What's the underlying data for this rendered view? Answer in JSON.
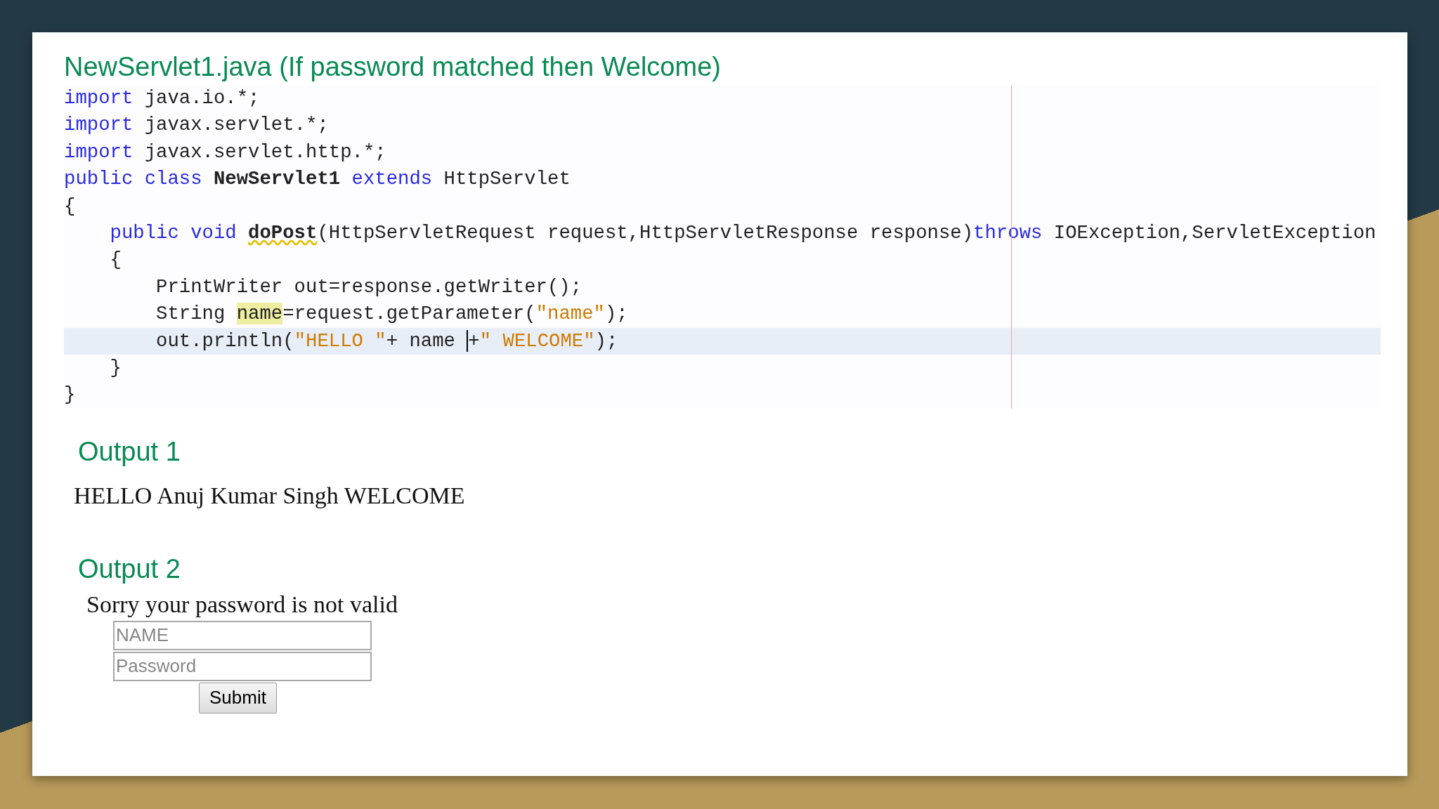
{
  "title": "NewServlet1.java (If password matched then Welcome)",
  "code": {
    "lines": [
      {
        "current": false,
        "tokens": [
          {
            "kind": "keyword",
            "text": "import"
          },
          {
            "kind": "plain",
            "text": " java.io.*;"
          }
        ]
      },
      {
        "current": false,
        "tokens": [
          {
            "kind": "keyword",
            "text": "import"
          },
          {
            "kind": "plain",
            "text": " javax.servlet.*;"
          }
        ]
      },
      {
        "current": false,
        "tokens": [
          {
            "kind": "keyword",
            "text": "import"
          },
          {
            "kind": "plain",
            "text": " javax.servlet.http.*;"
          }
        ]
      },
      {
        "current": false,
        "tokens": [
          {
            "kind": "keyword",
            "text": "public class "
          },
          {
            "kind": "bold",
            "text": "NewServlet1 "
          },
          {
            "kind": "keyword",
            "text": "extends"
          },
          {
            "kind": "plain",
            "text": " HttpServlet"
          }
        ]
      },
      {
        "current": false,
        "tokens": [
          {
            "kind": "plain",
            "text": "{"
          }
        ]
      },
      {
        "current": false,
        "tokens": [
          {
            "kind": "keyword",
            "text": "    public void "
          },
          {
            "kind": "warning",
            "text": "doPost"
          },
          {
            "kind": "plain",
            "text": "(HttpServletRequest request,HttpServletResponse response)"
          },
          {
            "kind": "keyword",
            "text": "throws"
          },
          {
            "kind": "plain",
            "text": " IOException,ServletException"
          }
        ]
      },
      {
        "current": false,
        "tokens": [
          {
            "kind": "plain",
            "text": "    {"
          }
        ]
      },
      {
        "current": false,
        "tokens": [
          {
            "kind": "plain",
            "text": "        PrintWriter out=response.getWriter();"
          }
        ]
      },
      {
        "current": false,
        "tokens": [
          {
            "kind": "plain",
            "text": "        String "
          },
          {
            "kind": "highlight",
            "text": "name"
          },
          {
            "kind": "plain",
            "text": "=request.getParameter("
          },
          {
            "kind": "string",
            "text": "\"name\""
          },
          {
            "kind": "plain",
            "text": ");"
          }
        ]
      },
      {
        "current": true,
        "tokens": [
          {
            "kind": "plain",
            "text": "        out.println("
          },
          {
            "kind": "string",
            "text": "\"HELLO \""
          },
          {
            "kind": "plain",
            "text": "+ name "
          },
          {
            "kind": "caret",
            "text": "+"
          },
          {
            "kind": "string",
            "text": "\" WELCOME\""
          },
          {
            "kind": "plain",
            "text": ");"
          }
        ]
      },
      {
        "current": false,
        "tokens": [
          {
            "kind": "plain",
            "text": "    }"
          }
        ]
      },
      {
        "current": false,
        "tokens": [
          {
            "kind": "plain",
            "text": "}"
          }
        ]
      }
    ]
  },
  "output1": {
    "heading": "Output 1",
    "text": "HELLO Anuj Kumar Singh WELCOME"
  },
  "output2": {
    "heading": "Output 2",
    "message": "Sorry your password is not valid",
    "fields": [
      {
        "placeholder": "NAME"
      },
      {
        "placeholder": "Password"
      }
    ],
    "button": "Submit"
  }
}
